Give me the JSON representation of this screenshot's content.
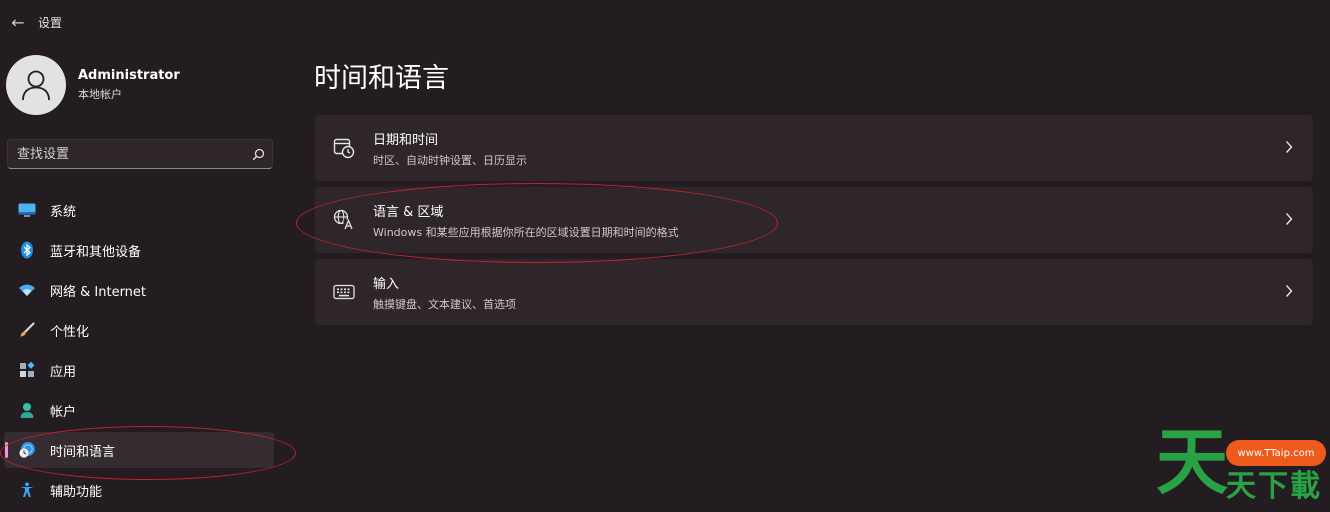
{
  "window": {
    "back_glyph": "←",
    "title": "设置"
  },
  "profile": {
    "name": "Administrator",
    "account_type": "本地帐户"
  },
  "search": {
    "placeholder": "查找设置"
  },
  "nav": {
    "items": [
      {
        "label": "系统",
        "icon": "system-display-icon"
      },
      {
        "label": "蓝牙和其他设备",
        "icon": "bluetooth-icon"
      },
      {
        "label": "网络 & Internet",
        "icon": "wifi-icon"
      },
      {
        "label": "个性化",
        "icon": "brush-icon"
      },
      {
        "label": "应用",
        "icon": "apps-icon"
      },
      {
        "label": "帐户",
        "icon": "person-icon"
      },
      {
        "label": "时间和语言",
        "icon": "time-language-icon",
        "active": true
      },
      {
        "label": "辅助功能",
        "icon": "accessibility-icon"
      }
    ]
  },
  "main": {
    "title": "时间和语言",
    "cards": [
      {
        "title": "日期和时间",
        "subtitle": "时区、自动时钟设置、日历显示",
        "icon": "calendar-clock-icon"
      },
      {
        "title": "语言 & 区域",
        "subtitle": "Windows 和某些应用根据你所在的区域设置日期和时间的格式",
        "icon": "language-icon"
      },
      {
        "title": "输入",
        "subtitle": "触摸键盘、文本建议、首选项",
        "icon": "keyboard-icon"
      }
    ]
  },
  "watermark": {
    "big_char": "天",
    "url": "www.TTaip.com",
    "small_text": "天下載"
  },
  "colors": {
    "accent": "#e89ad8",
    "annotation": "#c0232f",
    "background": "#231c20",
    "card": "#2e2629"
  }
}
